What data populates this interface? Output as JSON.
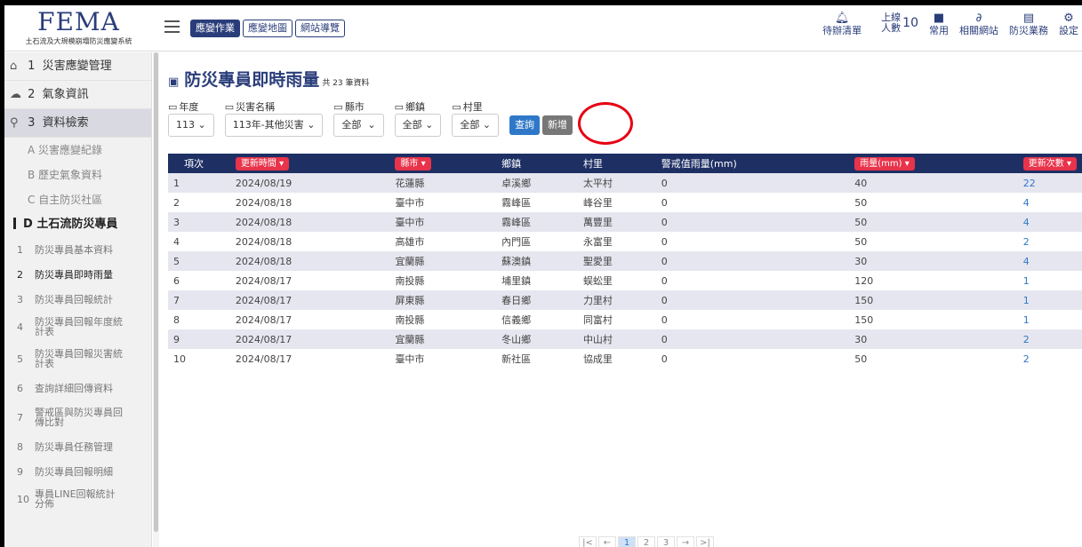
{
  "logo": {
    "brand": "FEMA",
    "subtitle": "土石流及大規模崩塌防災應變系統"
  },
  "top_tabs": [
    "應變作業",
    "應變地圖",
    "網站導覽"
  ],
  "top_right": {
    "todo": "待辦清單",
    "online_label_1": "上線",
    "online_label_2": "人數",
    "online_count": "10",
    "tools": [
      "常用",
      "相關網站",
      "防災業務",
      "設定"
    ]
  },
  "sidebar": {
    "items": [
      {
        "num": "1",
        "label": "災害應變管理"
      },
      {
        "num": "2",
        "label": "氣象資訊"
      },
      {
        "num": "3",
        "label": "資料檢索"
      }
    ],
    "subs": [
      "A 災害應變紀錄",
      "B 歷史氣象資料",
      "C 自主防災社區"
    ],
    "section": "D 土石流防災專員",
    "leaves": [
      {
        "n": "1",
        "t": "防災專員基本資料"
      },
      {
        "n": "2",
        "t": "防災專員即時雨量"
      },
      {
        "n": "3",
        "t": "防災專員回報統計"
      },
      {
        "n": "4",
        "t": "防災專員回報年度統計表"
      },
      {
        "n": "5",
        "t": "防災專員回報災害統計表"
      },
      {
        "n": "6",
        "t": "查詢詳細回傳資料"
      },
      {
        "n": "7",
        "t": "警戒區與防災專員回傳比對"
      },
      {
        "n": "8",
        "t": "防災專員任務管理"
      },
      {
        "n": "9",
        "t": "防災專員回報明細"
      },
      {
        "n": "10",
        "t": "專員LINE回報統計分佈"
      }
    ]
  },
  "page": {
    "title": "防災專員即時雨量",
    "count": "共 23 筆資料"
  },
  "filters": [
    {
      "label": "年度",
      "value": "113"
    },
    {
      "label": "災害名稱",
      "value": "113年-其他災害"
    },
    {
      "label": "縣市",
      "value": "全部"
    },
    {
      "label": "鄉鎮",
      "value": "全部"
    },
    {
      "label": "村里",
      "value": "全部"
    }
  ],
  "buttons": {
    "query": "查詢",
    "add": "新增"
  },
  "table": {
    "headers": [
      "項次",
      "更新時間",
      "縣市",
      "鄉鎮",
      "村里",
      "警戒值雨量(mm)",
      "雨量(mm)",
      "更新次數"
    ],
    "rows": [
      [
        "1",
        "2024/08/19",
        "花蓮縣",
        "卓溪鄉",
        "太平村",
        "0",
        "40",
        "22"
      ],
      [
        "2",
        "2024/08/18",
        "臺中市",
        "霧峰區",
        "峰谷里",
        "0",
        "50",
        "4"
      ],
      [
        "3",
        "2024/08/18",
        "臺中市",
        "霧峰區",
        "萬豐里",
        "0",
        "50",
        "4"
      ],
      [
        "4",
        "2024/08/18",
        "高雄市",
        "內門區",
        "永富里",
        "0",
        "50",
        "2"
      ],
      [
        "5",
        "2024/08/18",
        "宜蘭縣",
        "蘇澳鎮",
        "聖愛里",
        "0",
        "30",
        "4"
      ],
      [
        "6",
        "2024/08/17",
        "南投縣",
        "埔里鎮",
        "蜈蚣里",
        "0",
        "120",
        "1"
      ],
      [
        "7",
        "2024/08/17",
        "屏東縣",
        "春日鄉",
        "力里村",
        "0",
        "150",
        "1"
      ],
      [
        "8",
        "2024/08/17",
        "南投縣",
        "信義鄉",
        "同富村",
        "0",
        "150",
        "1"
      ],
      [
        "9",
        "2024/08/17",
        "宜蘭縣",
        "冬山鄉",
        "中山村",
        "0",
        "30",
        "2"
      ],
      [
        "10",
        "2024/08/17",
        "臺中市",
        "新社區",
        "協成里",
        "0",
        "50",
        "2"
      ]
    ]
  },
  "pager": {
    "first": "|<",
    "prev": "←",
    "pages": [
      "1",
      "2",
      "3"
    ],
    "next": "→",
    "last": ">|"
  },
  "colors": {
    "brand": "#2a3d7a",
    "header": "#1e2f64",
    "sort": "#e8334a",
    "link": "#2f78c8",
    "highlight": "#e60012"
  }
}
